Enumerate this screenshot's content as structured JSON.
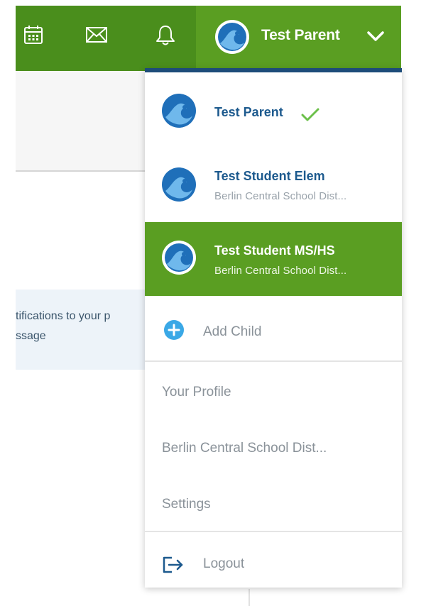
{
  "header": {
    "user_name": "Test Parent",
    "icons": {
      "calendar": "calendar-icon",
      "mail": "mail-icon",
      "bell": "bell-icon",
      "chevron": "chevron-down-icon"
    }
  },
  "background": {
    "banner_lines": [
      "tifications to your p",
      "ssage"
    ]
  },
  "dropdown": {
    "accounts": [
      {
        "name": "Test Parent",
        "sub": "",
        "selected": true
      },
      {
        "name": "Test Student Elem",
        "sub": "Berlin Central School Dist..."
      },
      {
        "name": "Test Student MS/HS",
        "sub": "Berlin Central School Dist...",
        "highlighted": true
      }
    ],
    "add_child": "Add Child",
    "links": [
      "Your Profile",
      "Berlin Central School Dist...",
      "Settings"
    ],
    "logout": "Logout"
  },
  "colors": {
    "header_green": "#4a8e1c",
    "accent_green": "#5a9e22",
    "navy": "#1d4c79",
    "link_blue": "#1d5a8e",
    "muted_text": "#8a9299",
    "check_green": "#6cc04a",
    "plus_blue": "#3aa8e6"
  }
}
